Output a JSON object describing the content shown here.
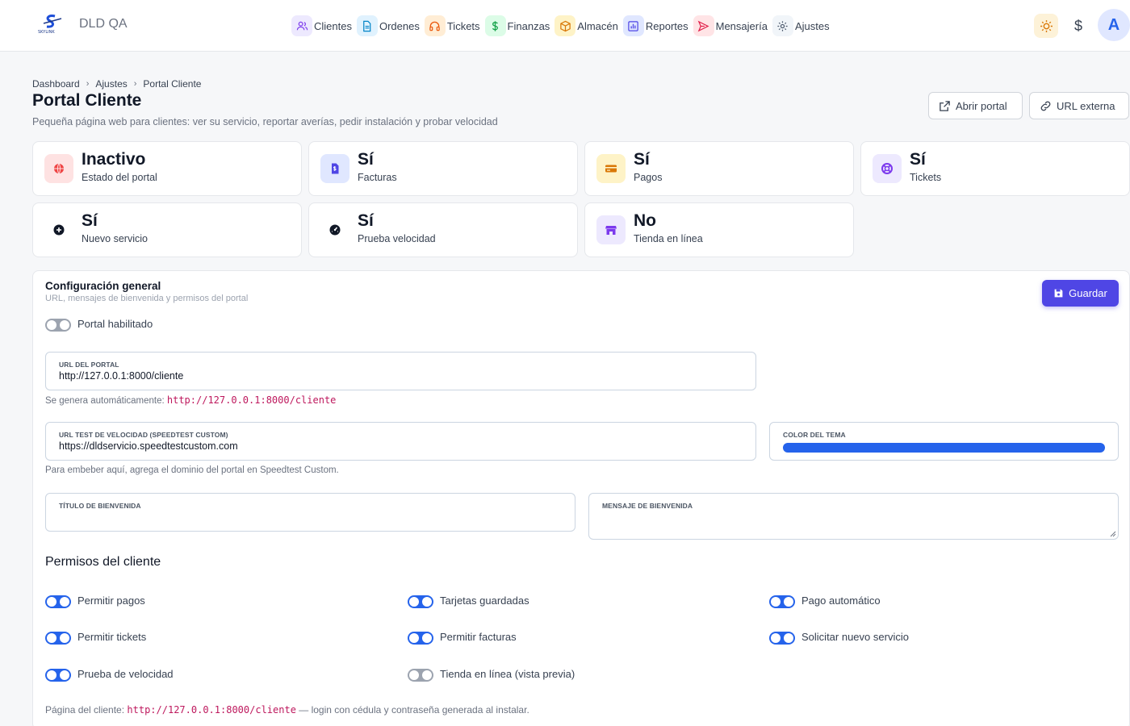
{
  "app": {
    "logo_text": "SKYLINK",
    "title": "DLD QA"
  },
  "nav": [
    {
      "label": "Clientes",
      "icon": "users-icon",
      "bg": "#ede9fe",
      "color": "#7c3aed"
    },
    {
      "label": "Ordenes",
      "icon": "document-icon",
      "bg": "#e0f2fe",
      "color": "#0284c7"
    },
    {
      "label": "Tickets",
      "icon": "headset-icon",
      "bg": "#ffedd5",
      "color": "#ea580c"
    },
    {
      "label": "Finanzas",
      "icon": "dollar-icon",
      "bg": "#dcfce7",
      "color": "#16a34a"
    },
    {
      "label": "Almacén",
      "icon": "box-icon",
      "bg": "#fef3c7",
      "color": "#d97706"
    },
    {
      "label": "Reportes",
      "icon": "chart-icon",
      "bg": "#e0e7ff",
      "color": "#4f46e5"
    },
    {
      "label": "Mensajería",
      "icon": "send-icon",
      "bg": "#ffe4e6",
      "color": "#e11d48"
    },
    {
      "label": "Ajustes",
      "icon": "gear-icon",
      "bg": "#f1f5f9",
      "color": "#475569"
    }
  ],
  "top_right": {
    "theme_icon": "sun-icon",
    "currency_symbol": "$",
    "avatar_initial": "A"
  },
  "breadcrumb": [
    "Dashboard",
    "Ajustes",
    "Portal Cliente"
  ],
  "page": {
    "title": "Portal Cliente",
    "subtitle": "Pequeña página web para clientes: ver su servicio, reportar averías, pedir instalación y probar velocidad"
  },
  "header_buttons": {
    "open_portal": "Abrir portal",
    "external_url": "URL externa"
  },
  "stats": [
    {
      "value": "Inactivo",
      "label": "Estado del portal",
      "icon": "globe-icon",
      "bg": "#fee2e2",
      "color": "#ef4444"
    },
    {
      "value": "Sí",
      "label": "Facturas",
      "icon": "invoice-icon",
      "bg": "#e0e7ff",
      "color": "#4f46e5"
    },
    {
      "value": "Sí",
      "label": "Pagos",
      "icon": "credit-card-icon",
      "bg": "#fef3c7",
      "color": "#d97706"
    },
    {
      "value": "Sí",
      "label": "Tickets",
      "icon": "lifebuoy-icon",
      "bg": "#ede9fe",
      "color": "#7c3aed"
    },
    {
      "value": "Sí",
      "label": "Nuevo servicio",
      "icon": "plus-circle-icon",
      "bg": "#ffffff",
      "color": "#111827"
    },
    {
      "value": "Sí",
      "label": "Prueba velocidad",
      "icon": "speedometer-icon",
      "bg": "#ffffff",
      "color": "#111827"
    },
    {
      "value": "No",
      "label": "Tienda en línea",
      "icon": "store-icon",
      "bg": "#ede9fe",
      "color": "#7c3aed"
    }
  ],
  "config": {
    "title": "Configuración general",
    "subtitle": "URL, mensajes de bienvenida y permisos del portal",
    "save_label": "Guardar",
    "portal_enabled_label": "Portal habilitado",
    "portal_enabled": false,
    "portal_url": {
      "label": "URL DEL PORTAL",
      "value": "http://127.0.0.1:8000/cliente",
      "helper_prefix": "Se genera automáticamente: ",
      "helper_code": "http://127.0.0.1:8000/cliente"
    },
    "speedtest_url": {
      "label": "URL TEST DE VELOCIDAD (SPEEDTEST CUSTOM)",
      "value": "https://dldservicio.speedtestcustom.com",
      "helper": "Para embeber aquí, agrega el dominio del portal en Speedtest Custom."
    },
    "theme_color": {
      "label": "COLOR DEL TEMA",
      "value": "#2563eb"
    },
    "welcome_title": {
      "label": "TÍTULO DE BIENVENIDA",
      "value": ""
    },
    "welcome_message": {
      "label": "MENSAJE DE BIENVENIDA",
      "value": ""
    }
  },
  "permissions": {
    "title": "Permisos del cliente",
    "items": [
      {
        "label": "Permitir pagos",
        "enabled": true
      },
      {
        "label": "Tarjetas guardadas",
        "enabled": true
      },
      {
        "label": "Pago automático",
        "enabled": true
      },
      {
        "label": "Permitir tickets",
        "enabled": true
      },
      {
        "label": "Permitir facturas",
        "enabled": true
      },
      {
        "label": "Solicitar nuevo servicio",
        "enabled": true
      },
      {
        "label": "Prueba de velocidad",
        "enabled": true
      },
      {
        "label": "Tienda en línea (vista previa)",
        "enabled": false
      }
    ]
  },
  "footer": {
    "prefix": "Página del cliente: ",
    "code": "http://127.0.0.1:8000/cliente",
    "suffix": " — login con cédula y contraseña generada al instalar."
  }
}
